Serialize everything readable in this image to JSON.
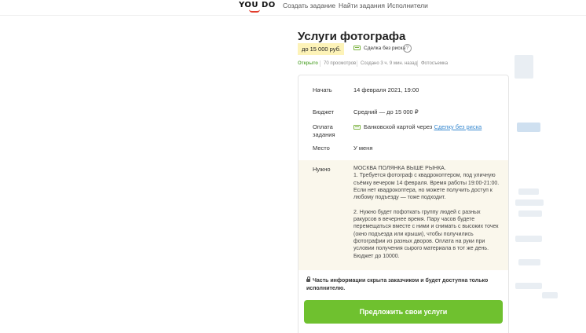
{
  "header": {
    "logo_text": "YOU DO",
    "nav": [
      "Создать задание",
      "Найти задания",
      "Исполнители"
    ]
  },
  "task": {
    "title": "Услуги фотографа",
    "price": "до 15 000 руб.",
    "safe_deal": "Сделка без риска",
    "help": "?",
    "meta": {
      "status": "Открыто",
      "views": "70 просмотров",
      "created": "Создано 3 ч. 9 мин. назад",
      "category": "Фотосъемка"
    }
  },
  "details": {
    "start_label": "Начать",
    "start_value": "14 февраля 2021, 19:00",
    "budget_label": "Бюджет",
    "budget_value": "Средний — до 15 000 ₽",
    "payment_label": "Оплата задания",
    "payment_value": "Банковской картой через",
    "payment_link": "Сделку без риска",
    "place_label": "Место",
    "place_value": "У меня",
    "needs_label": "Нужно",
    "needs_text": "МОСКВА ПОЛЯНКА ВЫШЕ РЫНКА.\n1. Требуется фотограф с квадрокоптером, под уличную съёмку вечером 14 февраля. Время работы 19:00-21:00. Если нет квадрокоптера, но можете получить доступ к любому подъезду — тоже подходит.\n\n2. Нужно будет пофоткать группу людей с разных ракурсов в вечернее время. Пару часов будете перемещаться вместе с ними и снимать с высоких точек (окно подъезда или крыши), чтобы получились фотографии из разных дворов. Оплата на руки при условии получения сырого материала в тот же день. Бюджет до 10000."
  },
  "hidden_note": "Часть информации скрыта заказчиком и будет доступна только исполнителю.",
  "cta_label": "Предложить свои услуги",
  "colors": {
    "accent_green": "#6fc12f",
    "price_highlight": "#fdf3b8",
    "link_blue": "#3a8ad0",
    "status_green": "#6ab04c",
    "logo_red": "#e23d2d"
  }
}
